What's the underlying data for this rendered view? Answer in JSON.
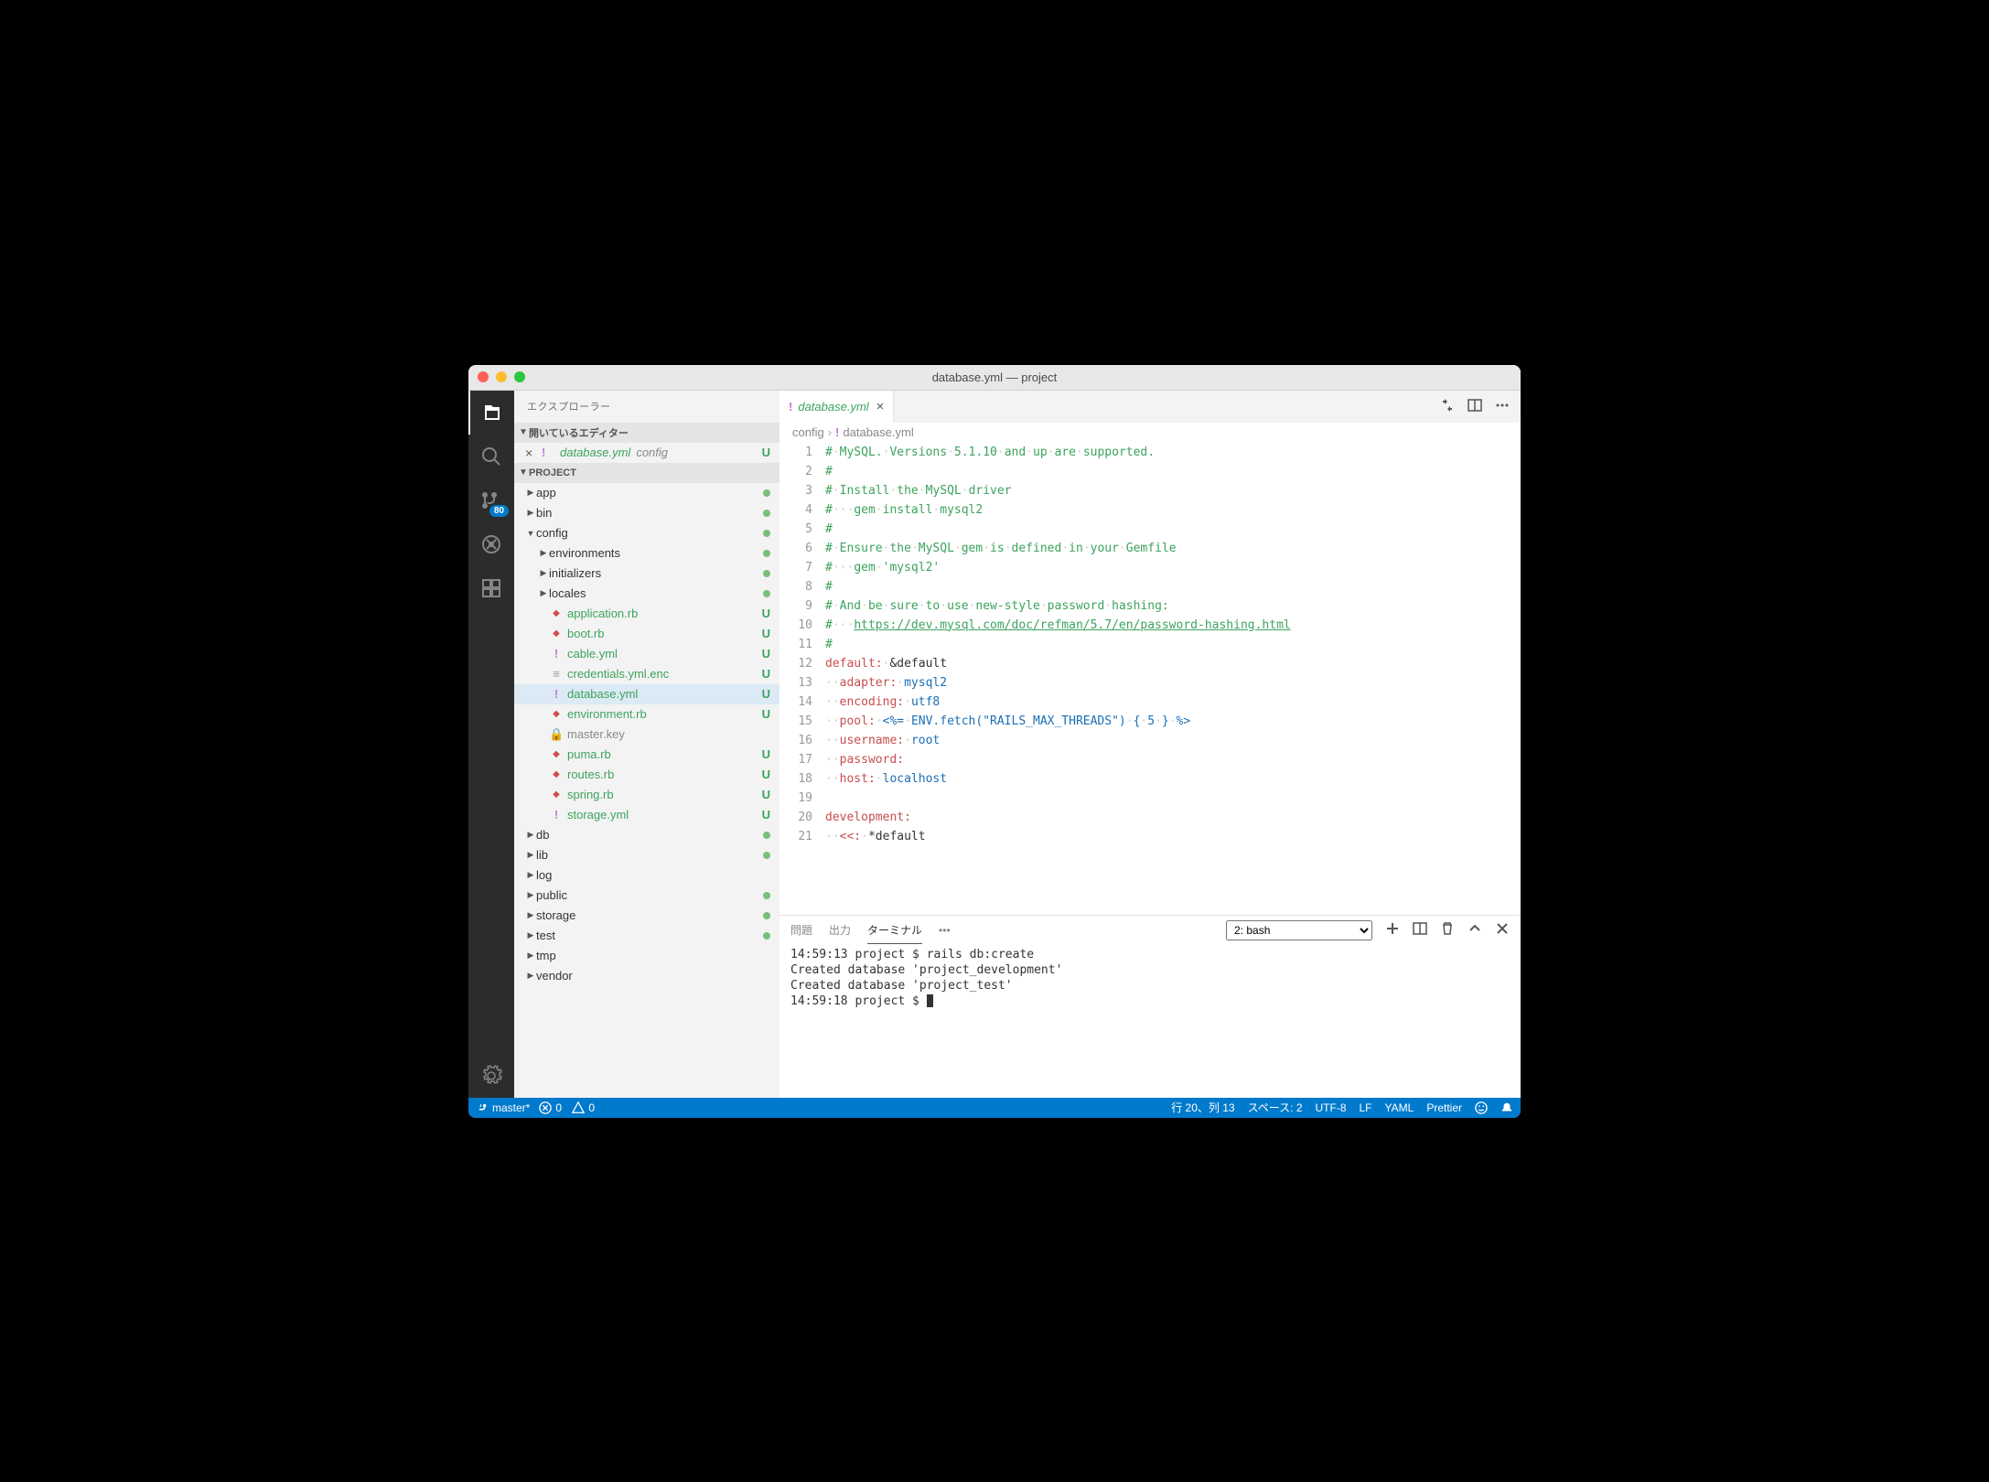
{
  "window": {
    "title": "database.yml — project"
  },
  "sidebar": {
    "title": "エクスプローラー",
    "openEditors": {
      "header": "開いているエディター"
    },
    "openFile": {
      "name": "database.yml",
      "path": "config",
      "status": "U"
    },
    "projectHeader": "PROJECT"
  },
  "tree": {
    "app": "app",
    "bin": "bin",
    "config": "config",
    "environments": "environments",
    "initializers": "initializers",
    "locales": "locales",
    "application_rb": "application.rb",
    "boot_rb": "boot.rb",
    "cable_yml": "cable.yml",
    "credentials": "credentials.yml.enc",
    "database_yml": "database.yml",
    "environment_rb": "environment.rb",
    "master_key": "master.key",
    "puma_rb": "puma.rb",
    "routes_rb": "routes.rb",
    "spring_rb": "spring.rb",
    "storage_yml": "storage.yml",
    "db": "db",
    "lib": "lib",
    "log": "log",
    "public": "public",
    "storage": "storage",
    "test": "test",
    "tmp": "tmp",
    "vendor": "vendor"
  },
  "badges": {
    "scm": "80"
  },
  "tab": {
    "name": "database.yml"
  },
  "breadcrumb": {
    "folder": "config",
    "file": "database.yml"
  },
  "code": {
    "l1": "# MySQL. Versions 5.1.10 and up are supported.",
    "l2": "#",
    "l3": "# Install the MySQL driver",
    "l4": "#   gem install mysql2",
    "l5": "#",
    "l6": "# Ensure the MySQL gem is defined in your Gemfile",
    "l7": "#   gem 'mysql2'",
    "l8": "#",
    "l9": "# And be sure to use new-style password hashing:",
    "l10a": "#   ",
    "l10b": "https://dev.mysql.com/doc/refman/5.7/en/password-hashing.html",
    "l11": "#",
    "l12k": "default:",
    "l12v": " &default",
    "l13k": "adapter:",
    "l13v": " mysql2",
    "l14k": "encoding:",
    "l14v": " utf8",
    "l15k": "pool:",
    "l15v": " <%= ENV.fetch(\"RAILS_MAX_THREADS\") { 5 } %>",
    "l16k": "username:",
    "l16v": " root",
    "l17k": "password:",
    "l18k": "host:",
    "l18v": " localhost",
    "l20k": "development:",
    "l21k": "<<:",
    "l21v": " *default"
  },
  "lineNumbers": [
    "1",
    "2",
    "3",
    "4",
    "5",
    "6",
    "7",
    "8",
    "9",
    "10",
    "11",
    "12",
    "13",
    "14",
    "15",
    "16",
    "17",
    "18",
    "19",
    "20",
    "21"
  ],
  "panel": {
    "tabs": {
      "problems": "問題",
      "output": "出力",
      "terminal": "ターミナル"
    },
    "terminalSelect": "2: bash",
    "term1": "14:59:13 project $ rails db:create",
    "term2": "Created database 'project_development'",
    "term3": "Created database 'project_test'",
    "term4": "14:59:18 project $ "
  },
  "status": {
    "branch": "master*",
    "errors": "0",
    "warnings": "0",
    "cursor": "行 20、列 13",
    "spaces": "スペース: 2",
    "encoding": "UTF-8",
    "eol": "LF",
    "lang": "YAML",
    "formatter": "Prettier"
  }
}
